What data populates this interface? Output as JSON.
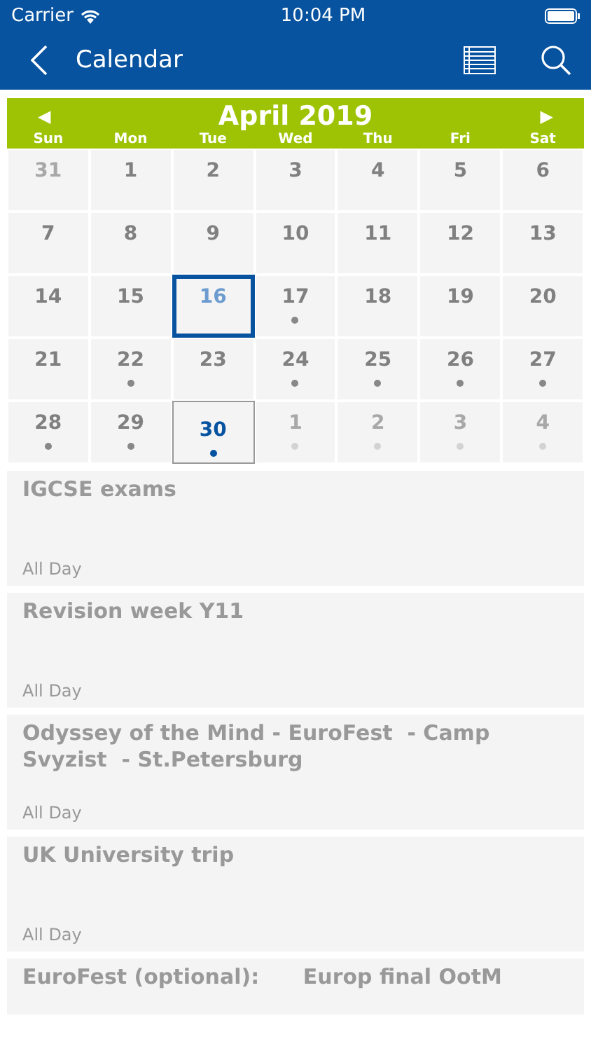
{
  "status_bar": {
    "carrier": "Carrier",
    "time": "10:04 PM"
  },
  "nav": {
    "title": "Calendar"
  },
  "calendar": {
    "month": "April 2019",
    "prev": "◀",
    "next": "▶",
    "weekdays": [
      "Sun",
      "Mon",
      "Tue",
      "Wed",
      "Thu",
      "Fri",
      "Sat"
    ],
    "weeks": [
      [
        {
          "day": "31",
          "muted": true,
          "selected": false,
          "today": false,
          "event": false
        },
        {
          "day": "1",
          "muted": false,
          "selected": false,
          "today": false,
          "event": false
        },
        {
          "day": "2",
          "muted": false,
          "selected": false,
          "today": false,
          "event": false
        },
        {
          "day": "3",
          "muted": false,
          "selected": false,
          "today": false,
          "event": false
        },
        {
          "day": "4",
          "muted": false,
          "selected": false,
          "today": false,
          "event": false
        },
        {
          "day": "5",
          "muted": false,
          "selected": false,
          "today": false,
          "event": false
        },
        {
          "day": "6",
          "muted": false,
          "selected": false,
          "today": false,
          "event": false
        }
      ],
      [
        {
          "day": "7",
          "muted": false,
          "selected": false,
          "today": false,
          "event": false
        },
        {
          "day": "8",
          "muted": false,
          "selected": false,
          "today": false,
          "event": false
        },
        {
          "day": "9",
          "muted": false,
          "selected": false,
          "today": false,
          "event": false
        },
        {
          "day": "10",
          "muted": false,
          "selected": false,
          "today": false,
          "event": false
        },
        {
          "day": "11",
          "muted": false,
          "selected": false,
          "today": false,
          "event": false
        },
        {
          "day": "12",
          "muted": false,
          "selected": false,
          "today": false,
          "event": false
        },
        {
          "day": "13",
          "muted": false,
          "selected": false,
          "today": false,
          "event": false
        }
      ],
      [
        {
          "day": "14",
          "muted": false,
          "selected": false,
          "today": false,
          "event": false
        },
        {
          "day": "15",
          "muted": false,
          "selected": false,
          "today": false,
          "event": false
        },
        {
          "day": "16",
          "muted": false,
          "selected": true,
          "today": false,
          "event": false
        },
        {
          "day": "17",
          "muted": false,
          "selected": false,
          "today": false,
          "event": true
        },
        {
          "day": "18",
          "muted": false,
          "selected": false,
          "today": false,
          "event": false
        },
        {
          "day": "19",
          "muted": false,
          "selected": false,
          "today": false,
          "event": false
        },
        {
          "day": "20",
          "muted": false,
          "selected": false,
          "today": false,
          "event": false
        }
      ],
      [
        {
          "day": "21",
          "muted": false,
          "selected": false,
          "today": false,
          "event": false
        },
        {
          "day": "22",
          "muted": false,
          "selected": false,
          "today": false,
          "event": true
        },
        {
          "day": "23",
          "muted": false,
          "selected": false,
          "today": false,
          "event": false
        },
        {
          "day": "24",
          "muted": false,
          "selected": false,
          "today": false,
          "event": true
        },
        {
          "day": "25",
          "muted": false,
          "selected": false,
          "today": false,
          "event": true
        },
        {
          "day": "26",
          "muted": false,
          "selected": false,
          "today": false,
          "event": true
        },
        {
          "day": "27",
          "muted": false,
          "selected": false,
          "today": false,
          "event": true
        }
      ],
      [
        {
          "day": "28",
          "muted": false,
          "selected": false,
          "today": false,
          "event": true
        },
        {
          "day": "29",
          "muted": false,
          "selected": false,
          "today": false,
          "event": true
        },
        {
          "day": "30",
          "muted": false,
          "selected": false,
          "today": true,
          "event": true
        },
        {
          "day": "1",
          "muted": true,
          "selected": false,
          "today": false,
          "event": true
        },
        {
          "day": "2",
          "muted": true,
          "selected": false,
          "today": false,
          "event": true
        },
        {
          "day": "3",
          "muted": true,
          "selected": false,
          "today": false,
          "event": true
        },
        {
          "day": "4",
          "muted": true,
          "selected": false,
          "today": false,
          "event": true
        }
      ]
    ]
  },
  "events": [
    {
      "title": "IGCSE exams",
      "time": "All Day"
    },
    {
      "title": "Revision week Y11",
      "time": "All Day"
    },
    {
      "title": "Odyssey of the Mind - EuroFest  - Camp Svyzist  - St.Petersburg",
      "time": "All Day"
    },
    {
      "title": "UK University trip",
      "time": "All Day"
    },
    {
      "title": "EuroFest (optional):      Europ final OotM"
    }
  ]
}
